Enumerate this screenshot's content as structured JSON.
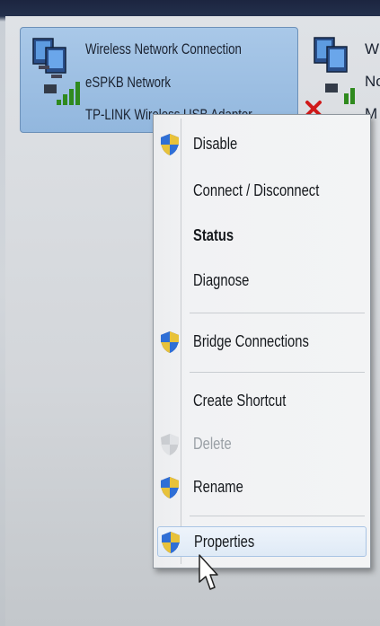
{
  "connection_tile": {
    "name": "Wireless Network Connection",
    "network": "eSPKB Network",
    "adapter": "TP-LINK Wireless USB Adapter"
  },
  "second_tile": {
    "line1": "W",
    "line2": "No",
    "line3": "M"
  },
  "context_menu": {
    "items": [
      {
        "label": "Disable",
        "icon": "uac-shield-icon"
      },
      {
        "label": "Connect / Disconnect"
      },
      {
        "label": "Status",
        "bold": true
      },
      {
        "label": "Diagnose"
      },
      {
        "label": "Bridge Connections",
        "icon": "uac-shield-icon"
      },
      {
        "label": "Create Shortcut"
      },
      {
        "label": "Delete",
        "icon": "uac-shield-icon",
        "disabled": true
      },
      {
        "label": "Rename",
        "icon": "uac-shield-icon"
      },
      {
        "label": "Properties",
        "icon": "uac-shield-icon",
        "hovered": true
      }
    ]
  },
  "colors": {
    "selection": "#a9c8e8",
    "menu_bg": "#f3f4f5",
    "hover_border": "#a9c4e4",
    "error_x": "#d01a1a",
    "signal": "#2f8a1e"
  }
}
